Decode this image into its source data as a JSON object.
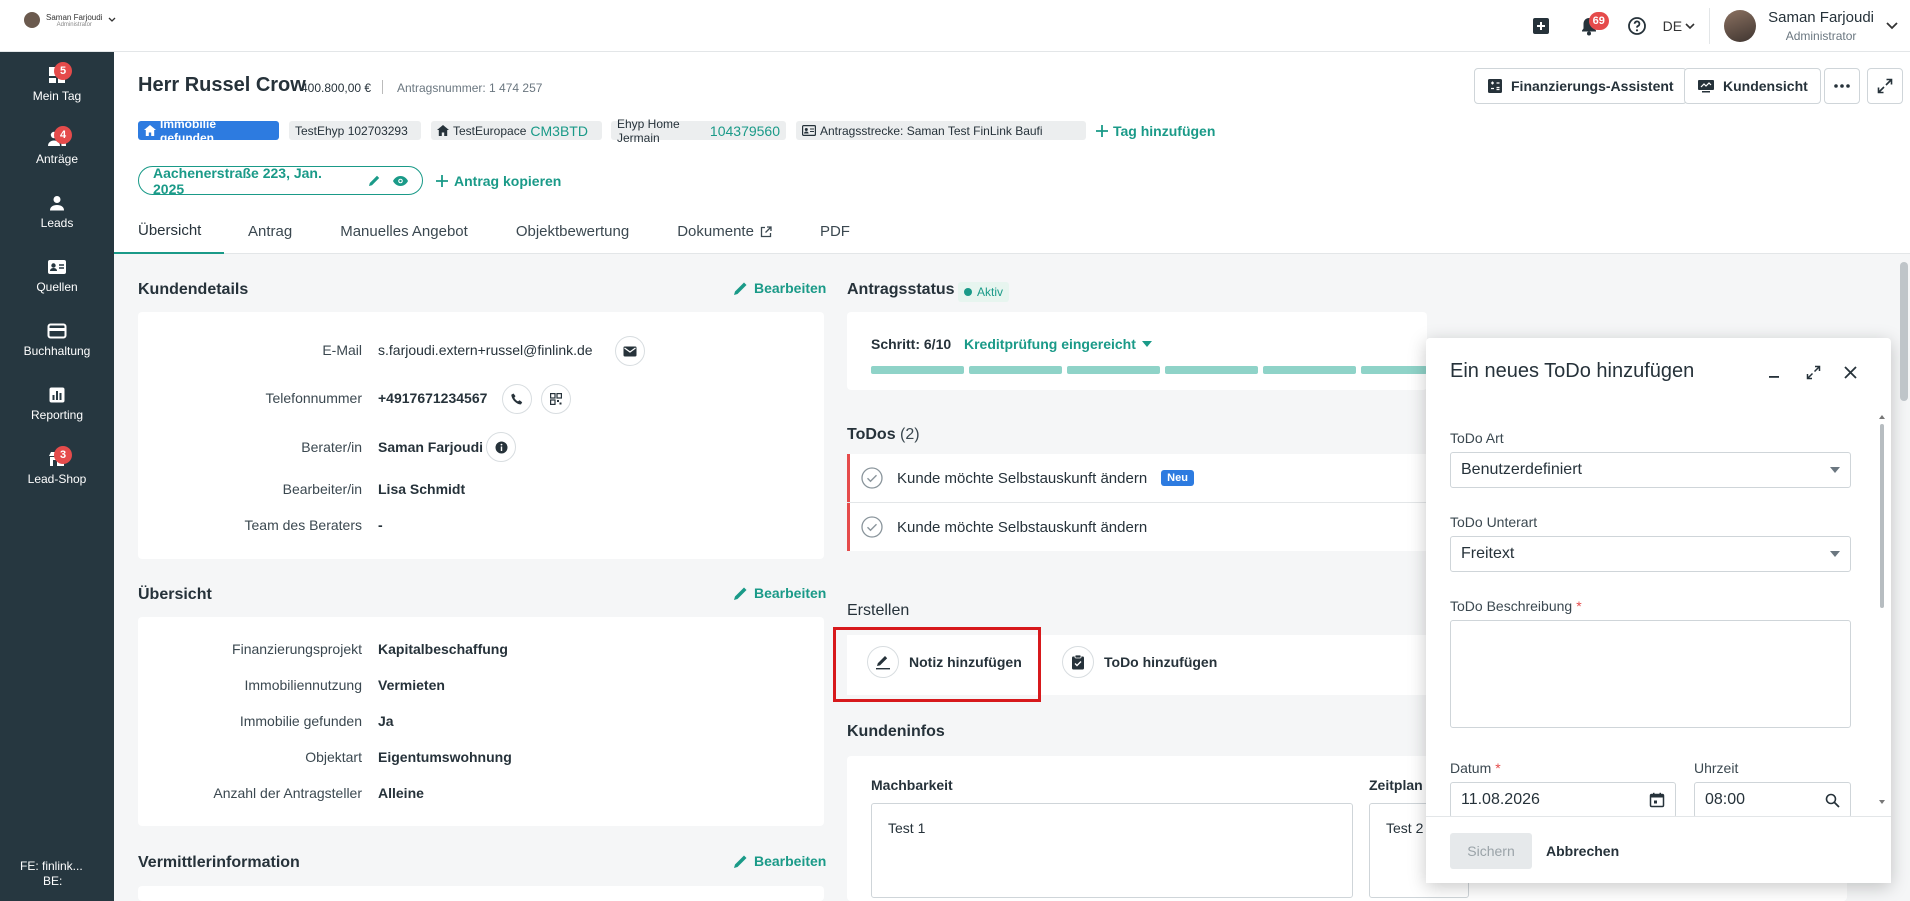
{
  "topbar": {
    "mini_user_name": "Saman Farjoudi",
    "mini_user_role": "Administrator",
    "notifications_count": "69",
    "language": "DE",
    "user_name": "Saman Farjoudi",
    "user_role": "Administrator"
  },
  "sidebar": {
    "items": [
      {
        "label": "Mein Tag",
        "badge": "5",
        "icon": "dashboard-icon"
      },
      {
        "label": "Anträge",
        "badge": "4",
        "icon": "people-icon"
      },
      {
        "label": "Leads",
        "badge": "",
        "icon": "person-icon"
      },
      {
        "label": "Quellen",
        "badge": "",
        "icon": "contact-card-icon"
      },
      {
        "label": "Buchhaltung",
        "badge": "",
        "icon": "credit-card-icon"
      },
      {
        "label": "Reporting",
        "badge": "",
        "icon": "bar-chart-icon"
      },
      {
        "label": "Lead-Shop",
        "badge": "3",
        "icon": "store-icon"
      }
    ],
    "footer_fe": "FE: finlink...",
    "footer_be": "BE:"
  },
  "header": {
    "title": "Herr Russel Crow",
    "amount": "400.800,00 €",
    "antrag_nr": "Antragsnummer: 1 474 257",
    "btn_assistant": "Finanzierungs-Assistent",
    "btn_customer_view": "Kundensicht",
    "tags": {
      "immobilie": "Immobilie gefunden",
      "testehyp": "TestEhyp 102703293",
      "testeuropace_label": "TestEuropace",
      "testeuropace_id": "CM3BTD",
      "ehyp_label": "Ehyp Home Jermain",
      "ehyp_id": "104379560",
      "strecke": "Antragsstrecke: Saman Test FinLink Baufi",
      "add": "Tag hinzufügen"
    },
    "address_pill": "Aachenerstraße 223, Jan. 2025",
    "copy_link": "Antrag kopieren",
    "tabs": [
      "Übersicht",
      "Antrag",
      "Manuelles Angebot",
      "Objektbewertung",
      "Dokumente",
      "PDF"
    ]
  },
  "kundendetails": {
    "title": "Kundendetails",
    "edit": "Bearbeiten",
    "rows": [
      {
        "label": "E-Mail",
        "value": "s.farjoudi.extern+russel@finlink.de"
      },
      {
        "label": "Telefonnummer",
        "value": "+4917671234567"
      },
      {
        "label": "Berater/in",
        "value": "Saman Farjoudi"
      },
      {
        "label": "Bearbeiter/in",
        "value": "Lisa Schmidt"
      },
      {
        "label": "Team des Beraters",
        "value": "-"
      }
    ]
  },
  "uebersicht": {
    "title": "Übersicht",
    "edit": "Bearbeiten",
    "rows": [
      {
        "label": "Finanzierungsprojekt",
        "value": "Kapitalbeschaffung"
      },
      {
        "label": "Immobiliennutzung",
        "value": "Vermieten"
      },
      {
        "label": "Immobilie gefunden",
        "value": "Ja"
      },
      {
        "label": "Objektart",
        "value": "Eigentumswohnung"
      },
      {
        "label": "Anzahl der Antragsteller",
        "value": "Alleine"
      }
    ]
  },
  "vermittler": {
    "title": "Vermittlerinformation",
    "edit": "Bearbeiten"
  },
  "antragsstatus": {
    "title": "Antragsstatus",
    "status": "Aktiv",
    "step_label": "Schritt: 6/10",
    "step_name": "Kreditprüfung eingereicht",
    "steps_done": 6,
    "steps_total": 10
  },
  "todos": {
    "title": "ToDos",
    "count": "(2)",
    "items": [
      {
        "text": "Kunde möchte Selbstauskunft ändern",
        "badge": "Neu"
      },
      {
        "text": "Kunde möchte Selbstauskunft ändern",
        "badge": ""
      }
    ]
  },
  "erstellen": {
    "title": "Erstellen",
    "note": "Notiz hinzufügen",
    "todo": "ToDo hinzufügen"
  },
  "kundeninfos": {
    "title": "Kundeninfos",
    "col1_label": "Machbarkeit",
    "col1_value": "Test 1",
    "col2_label": "Zeitplan &",
    "col2_value": "Test 2"
  },
  "modal": {
    "title": "Ein neues ToDo hinzufügen",
    "art_label": "ToDo Art",
    "art_value": "Benutzerdefiniert",
    "unterart_label": "ToDo Unterart",
    "unterart_value": "Freitext",
    "beschreibung_label": "ToDo Beschreibung",
    "beschreibung_value": "",
    "datum_label": "Datum",
    "datum_value": "11.08.2026",
    "uhrzeit_label": "Uhrzeit",
    "uhrzeit_value": "08:00",
    "save": "Sichern",
    "cancel": "Abbrechen"
  },
  "colors": {
    "accent": "#1a9a88",
    "sidebar": "#263740",
    "badge": "#e54b4b",
    "tag_blue": "#2d7be0",
    "highlight": "#d7191c"
  }
}
